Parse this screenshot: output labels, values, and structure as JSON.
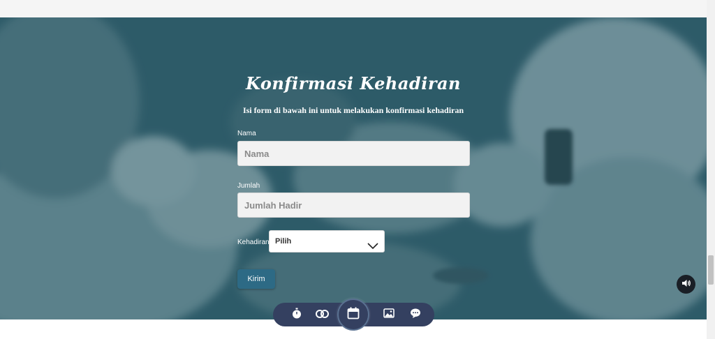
{
  "rsvp": {
    "title": "Konfirmasi Kehadiran",
    "subtitle": "Isi form di bawah ini untuk melakukan konfirmasi kehadiran",
    "name_label": "Nama",
    "name_placeholder": "Nama",
    "count_label": "Jumlah",
    "count_placeholder": "Jumlah Hadir",
    "attendance_label": "Kehadiran",
    "attendance_selected": "Pilih",
    "submit_label": "Kirim"
  },
  "nav": {
    "items": [
      {
        "icon": "stopwatch-icon"
      },
      {
        "icon": "couple-icon"
      },
      {
        "icon": "calendar-icon",
        "active": true
      },
      {
        "icon": "gallery-icon"
      },
      {
        "icon": "chat-icon"
      }
    ]
  },
  "audio": {
    "icon": "volume-icon"
  },
  "colors": {
    "hero_overlay": "#235462",
    "nav_bg": "#344060",
    "submit_bg": "#2d6a85"
  }
}
